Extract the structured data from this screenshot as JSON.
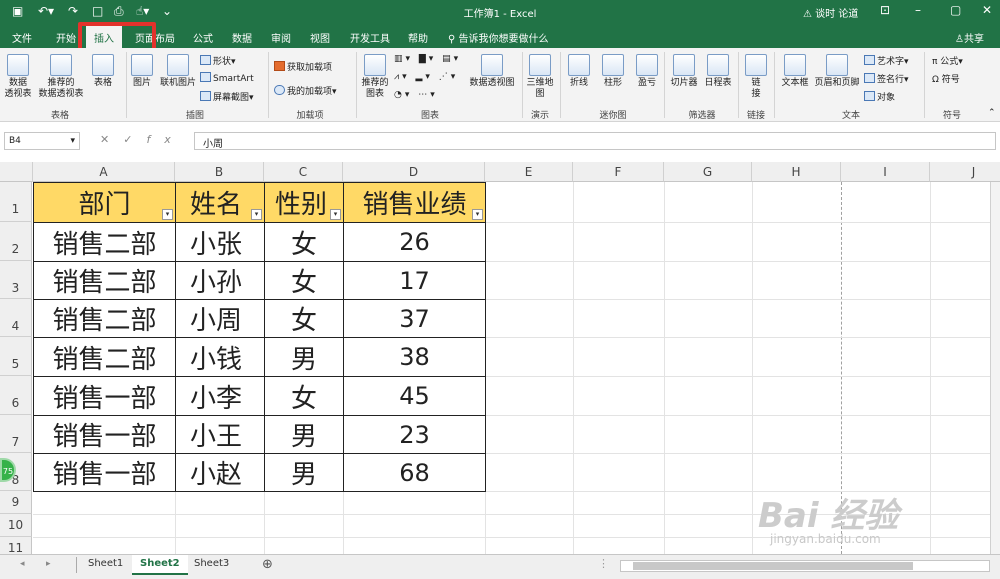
{
  "titlebar": {
    "save_icon": "save-icon",
    "undo_icon": "undo-icon",
    "redo_icon": "redo-icon",
    "title": "工作簿1  -  Excel",
    "user": "⚠ 谈时 论道",
    "window_controls": [
      "restore-ribbon-icon",
      "minimize-icon",
      "maximize-icon",
      "close-icon"
    ]
  },
  "tabs": [
    "文件",
    "开始",
    "插入",
    "页面布局",
    "公式",
    "数据",
    "审阅",
    "视图",
    "开发工具",
    "帮助"
  ],
  "active_tab": "插入",
  "tellme": "告诉我你想要做什么",
  "share": "共享",
  "ribbon": {
    "groups": [
      "表格",
      "插图",
      "加载项",
      "图表",
      "演示",
      "迷你图",
      "筛选器",
      "链接",
      "文本",
      "符号"
    ],
    "tables": [
      "数据\n透视表",
      "推荐的\n数据透视表",
      "表格"
    ],
    "illustrations": [
      "图片",
      "联机图片"
    ],
    "illustrations_small": [
      "形状",
      "SmartArt",
      "屏幕截图"
    ],
    "addins": [
      "获取加载项",
      "我的加载项"
    ],
    "charts": [
      "推荐的\n图表",
      "数据透视图"
    ],
    "tour": [
      "三维地\n图"
    ],
    "sparklines": [
      "折线",
      "柱形",
      "盈亏"
    ],
    "filters": [
      "切片器",
      "日程表"
    ],
    "links": [
      "链\n接"
    ],
    "text": [
      "文本框",
      "页眉和页脚"
    ],
    "text_small": [
      "艺术字",
      "签名行",
      "对象"
    ],
    "symbols_small": [
      "公式",
      "符号"
    ]
  },
  "formula_bar": {
    "name_box": "B4",
    "formula": "小周",
    "fx_label": "fx"
  },
  "columns": [
    "A",
    "B",
    "C",
    "D",
    "E",
    "F",
    "G",
    "H",
    "I",
    "J"
  ],
  "rows": [
    "1",
    "2",
    "3",
    "4",
    "5",
    "6",
    "7",
    "8",
    "9",
    "10",
    "11"
  ],
  "table": {
    "headers": [
      "部门",
      "姓名",
      "性别",
      "销售业绩"
    ],
    "rows": [
      [
        "销售二部",
        "小张",
        "女",
        "26"
      ],
      [
        "销售二部",
        "小孙",
        "女",
        "17"
      ],
      [
        "销售二部",
        "小周",
        "女",
        "37"
      ],
      [
        "销售二部",
        "小钱",
        "男",
        "38"
      ],
      [
        "销售一部",
        "小李",
        "女",
        "45"
      ],
      [
        "销售一部",
        "小王",
        "男",
        "23"
      ],
      [
        "销售一部",
        "小赵",
        "男",
        "68"
      ]
    ],
    "header_fill": "#ffd966"
  },
  "sheets": [
    "Sheet1",
    "Sheet2",
    "Sheet3"
  ],
  "active_sheet": "Sheet2",
  "add_sheet": "⊕",
  "badge": "75",
  "watermark": "Bai 经验",
  "watermark_sub": "jingyan.baidu.com",
  "colors": {
    "excel_green": "#217346",
    "highlight": "#e2322c"
  }
}
